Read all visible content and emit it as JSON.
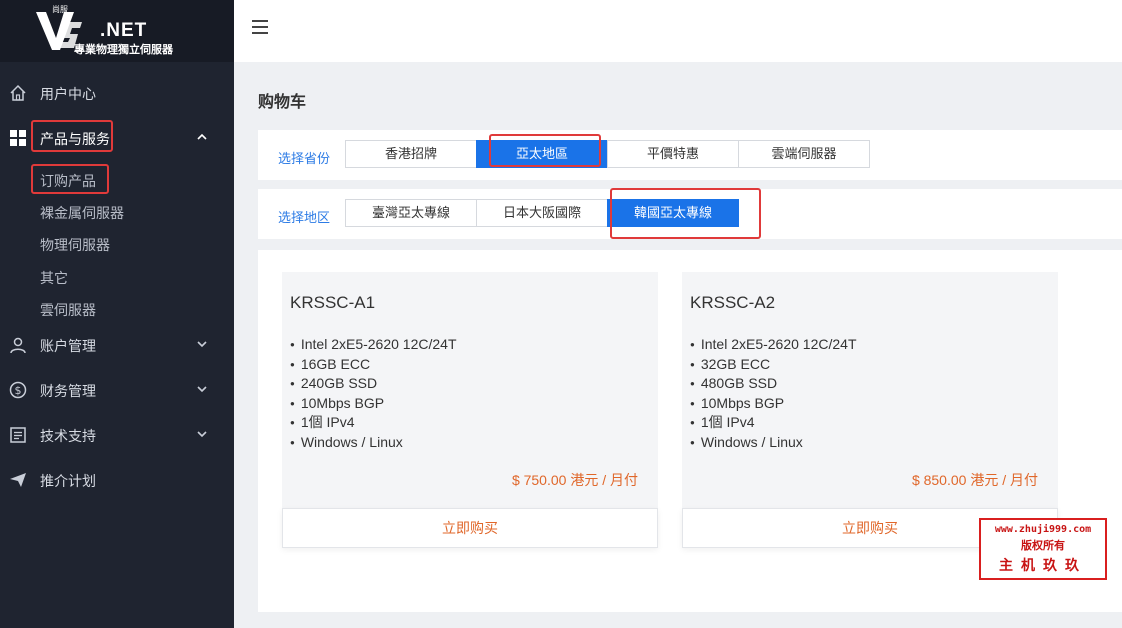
{
  "logo": {
    "brand": ".NET",
    "tagline": "專業物理獨立伺服器",
    "badge": "尚服"
  },
  "sidebar": {
    "items": [
      {
        "label": "用户中心",
        "icon": "home-icon"
      },
      {
        "label": "产品与服务",
        "icon": "grid-icon",
        "expanded": true
      },
      {
        "label": "账户管理",
        "icon": "user-icon"
      },
      {
        "label": "财务管理",
        "icon": "dollar-icon"
      },
      {
        "label": "技术支持",
        "icon": "document-icon"
      },
      {
        "label": "推介计划",
        "icon": "send-icon"
      }
    ],
    "sub_items": [
      "订购产品",
      "裸金属伺服器",
      "物理伺服器",
      "其它",
      "雲伺服器"
    ]
  },
  "page": {
    "title": "购物车"
  },
  "filters": {
    "province_label": "选择省份",
    "provinces": [
      "香港招牌",
      "亞太地區",
      "平價特惠",
      "雲端伺服器"
    ],
    "province_selected": "亞太地區",
    "region_label": "选择地区",
    "regions": [
      "臺灣亞太專線",
      "日本大阪國際",
      "韓國亞太專線"
    ],
    "region_selected": "韓國亞太專線"
  },
  "products": [
    {
      "name": "KRSSC-A1",
      "specs": [
        "Intel 2xE5-2620 12C/24T",
        "16GB ECC",
        "240GB SSD",
        "10Mbps BGP",
        "1個 IPv4",
        "Windows / Linux"
      ],
      "price": "$ 750.00 港元 / 月付",
      "buy_label": "立即购买"
    },
    {
      "name": "KRSSC-A2",
      "specs": [
        "Intel 2xE5-2620 12C/24T",
        "32GB ECC",
        "480GB SSD",
        "10Mbps BGP",
        "1個 IPv4",
        "Windows / Linux"
      ],
      "price": "$ 850.00 港元 / 月付",
      "buy_label": "立即购买"
    }
  ],
  "watermark": {
    "url": "www.zhuji999.com",
    "rights": "版权所有",
    "name": "主机玖玖"
  },
  "colors": {
    "accent": "#1a73e8",
    "price": "#e0672a",
    "highlight": "#e03a3a",
    "sidebar_bg": "#1f2430"
  }
}
